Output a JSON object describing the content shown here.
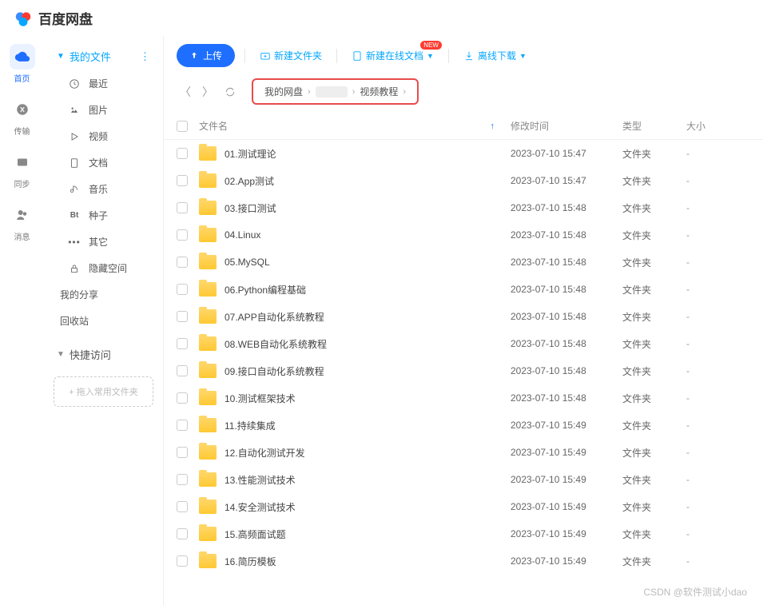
{
  "app": {
    "name": "百度网盘"
  },
  "left_nav": {
    "items": [
      {
        "label": "首页",
        "active": true
      },
      {
        "label": "传输",
        "active": false
      },
      {
        "label": "同步",
        "active": false
      },
      {
        "label": "消息",
        "active": false
      }
    ]
  },
  "sidebar": {
    "my_files": {
      "label": "我的文件"
    },
    "categories": [
      {
        "label": "最近",
        "icon": "clock"
      },
      {
        "label": "图片",
        "icon": "image"
      },
      {
        "label": "视频",
        "icon": "play"
      },
      {
        "label": "文档",
        "icon": "doc"
      },
      {
        "label": "音乐",
        "icon": "music"
      },
      {
        "label": "种子",
        "icon": "bt"
      },
      {
        "label": "其它",
        "icon": "dots"
      },
      {
        "label": "隐藏空间",
        "icon": "lock"
      }
    ],
    "extras": [
      {
        "label": "我的分享"
      },
      {
        "label": "回收站"
      }
    ],
    "quick": {
      "label": "快捷访问"
    },
    "dropzone": "+ 拖入常用文件夹"
  },
  "toolbar": {
    "upload": "上传",
    "new_folder": "新建文件夹",
    "new_online": "新建在线文档",
    "new_badge": "NEW",
    "offline": "离线下载"
  },
  "breadcrumb": {
    "items": [
      "我的网盘",
      "",
      "视频教程"
    ]
  },
  "table": {
    "headers": {
      "name": "文件名",
      "time": "修改时间",
      "type": "类型",
      "size": "大小"
    }
  },
  "files": [
    {
      "name": "01.测试理论",
      "time": "2023-07-10 15:47",
      "type": "文件夹",
      "size": "-"
    },
    {
      "name": "02.App测试",
      "time": "2023-07-10 15:47",
      "type": "文件夹",
      "size": "-"
    },
    {
      "name": "03.接口测试",
      "time": "2023-07-10 15:48",
      "type": "文件夹",
      "size": "-"
    },
    {
      "name": "04.Linux",
      "time": "2023-07-10 15:48",
      "type": "文件夹",
      "size": "-"
    },
    {
      "name": "05.MySQL",
      "time": "2023-07-10 15:48",
      "type": "文件夹",
      "size": "-"
    },
    {
      "name": "06.Python编程基础",
      "time": "2023-07-10 15:48",
      "type": "文件夹",
      "size": "-"
    },
    {
      "name": "07.APP自动化系统教程",
      "time": "2023-07-10 15:48",
      "type": "文件夹",
      "size": "-"
    },
    {
      "name": "08.WEB自动化系统教程",
      "time": "2023-07-10 15:48",
      "type": "文件夹",
      "size": "-"
    },
    {
      "name": "09.接口自动化系统教程",
      "time": "2023-07-10 15:48",
      "type": "文件夹",
      "size": "-"
    },
    {
      "name": "10.测试框架技术",
      "time": "2023-07-10 15:48",
      "type": "文件夹",
      "size": "-"
    },
    {
      "name": "11.持续集成",
      "time": "2023-07-10 15:49",
      "type": "文件夹",
      "size": "-"
    },
    {
      "name": "12.自动化测试开发",
      "time": "2023-07-10 15:49",
      "type": "文件夹",
      "size": "-"
    },
    {
      "name": "13.性能测试技术",
      "time": "2023-07-10 15:49",
      "type": "文件夹",
      "size": "-"
    },
    {
      "name": "14.安全测试技术",
      "time": "2023-07-10 15:49",
      "type": "文件夹",
      "size": "-"
    },
    {
      "name": "15.高频面试题",
      "time": "2023-07-10 15:49",
      "type": "文件夹",
      "size": "-"
    },
    {
      "name": "16.简历模板",
      "time": "2023-07-10 15:49",
      "type": "文件夹",
      "size": "-"
    }
  ],
  "watermark": "CSDN @软件测试小dao"
}
